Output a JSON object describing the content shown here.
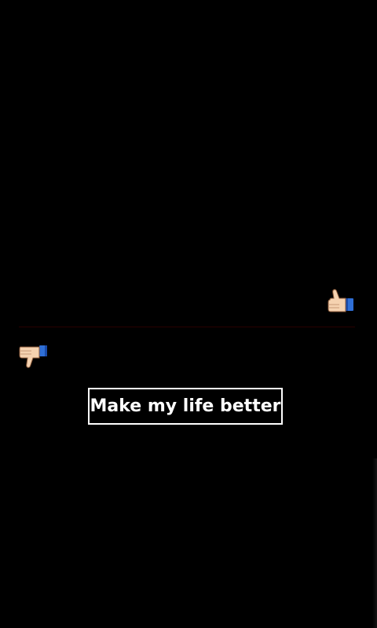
{
  "screen": {
    "background_color": "#000000",
    "divider_color": "#2a0000"
  },
  "icons": {
    "upvote": "thumbs-up-icon",
    "downvote": "thumbs-down-icon"
  },
  "action_button": {
    "label": "Make my life better",
    "border_color": "#ffffff",
    "text_color": "#ffffff"
  }
}
